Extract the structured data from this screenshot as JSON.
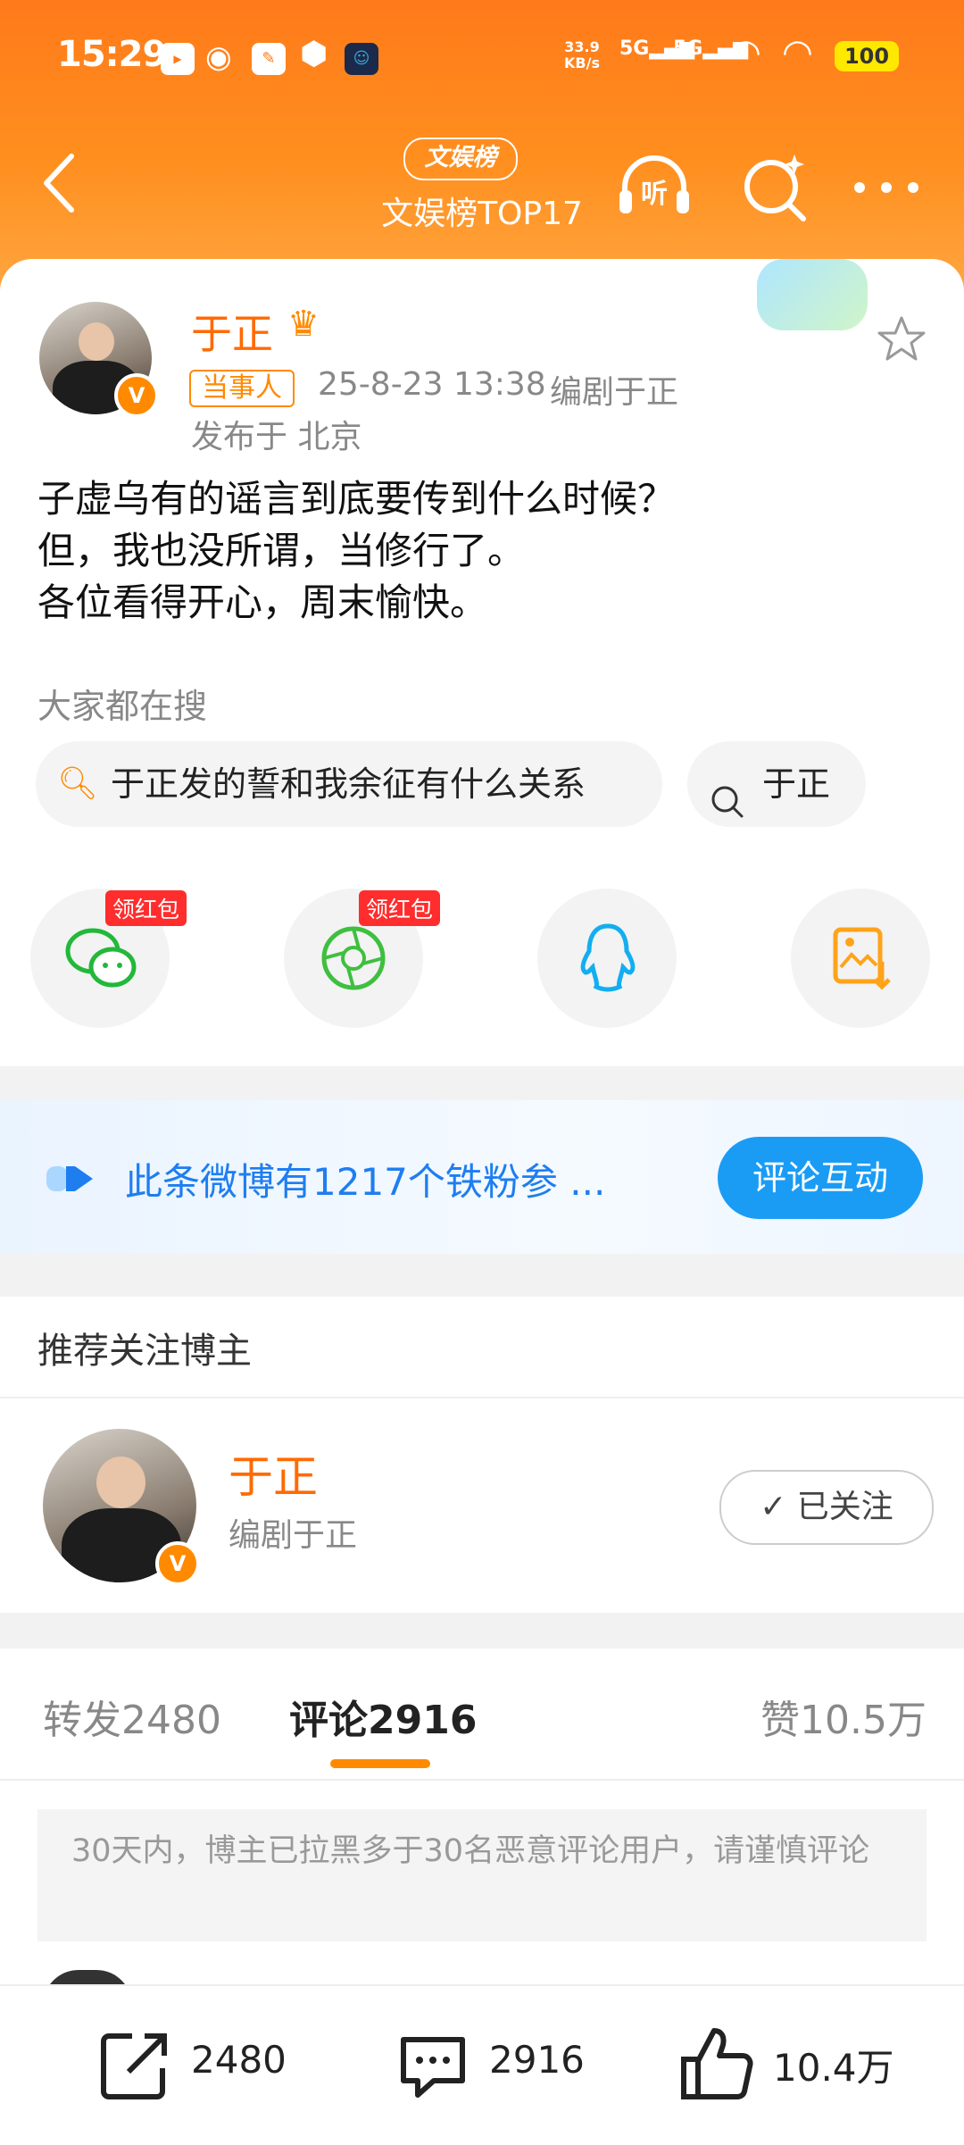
{
  "status_bar": {
    "time": "15:29",
    "net_speed_value": "33.9",
    "net_speed_unit": "KB/s",
    "signal1": "5G",
    "signal2": "5G",
    "battery": "100"
  },
  "header": {
    "badge": "文娱榜",
    "title": "文娱榜TOP17",
    "listen_label": "听"
  },
  "post": {
    "author": "于正",
    "tag": "当事人",
    "timestamp": "25-8-23 13:38",
    "author_role": "编剧于正",
    "location": "发布于 北京",
    "lines": [
      "子虚乌有的谣言到底要传到什么时候？",
      "但，我也没所谓，当修行了。",
      "各位看得开心，周末愉快。"
    ]
  },
  "search_section": {
    "heading": "大家都在搜",
    "chips": [
      {
        "label": "于正发的誓和我余征有什么关系",
        "icon": "hot-search-icon"
      },
      {
        "label": "于正",
        "icon": "search-icon"
      }
    ]
  },
  "share": {
    "redpacket_label": "领红包",
    "targets": [
      {
        "icon": "wechat-icon",
        "color": "#22b83a"
      },
      {
        "icon": "moments-icon",
        "color": "#3fbf3f"
      },
      {
        "icon": "qq-icon",
        "color": "#12aef0"
      },
      {
        "icon": "save-image-icon",
        "color": "#ffa31a"
      }
    ]
  },
  "banner": {
    "text": "此条微博有1217个铁粉参 ...",
    "button": "评论互动"
  },
  "recommend": {
    "heading": "推荐关注博主",
    "name": "于正",
    "subtitle": "编剧于正",
    "follow_label": "已关注"
  },
  "tabs": [
    {
      "label": "转发",
      "count": "2480"
    },
    {
      "label": "评论",
      "count": "2916"
    },
    {
      "label": "赞",
      "count": "10.5万"
    }
  ],
  "notice": "30天内，博主已拉黑多于30名恶意评论用户，请谨慎评论",
  "bottom_bar": {
    "repost": "2480",
    "comment": "2916",
    "like": "10.4万"
  },
  "colors": {
    "brand_orange": "#ff7a1a",
    "link_blue": "#1e7ef0",
    "accent_orange": "#ff8a00"
  }
}
